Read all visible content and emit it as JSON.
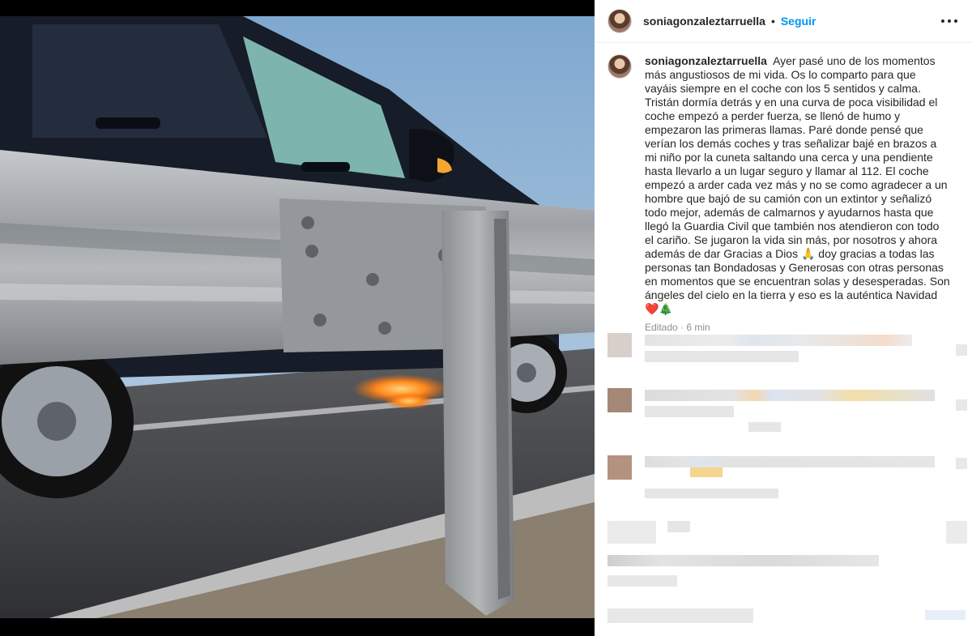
{
  "post": {
    "author": {
      "username": "soniagonzaleztarruella",
      "avatar_icon": "profile-avatar"
    },
    "header": {
      "separator": "•",
      "follow_label": "Seguir",
      "more_icon": "more-options-icon"
    },
    "caption": {
      "text": "Ayer pasé uno de los momentos más angustiosos de mi vida. Os lo comparto para que vayáis siempre en el coche con los 5 sentidos y calma. Tristán dormía detrás y en una curva de poca visibilidad el coche empezó a perder fuerza, se llenó de humo y empezaron las primeras llamas. Paré donde pensé que verían los demás coches y tras señalizar bajé en brazos a mi niño por la cuneta saltando una cerca y una pendiente hasta llevarlo a un lugar seguro y llamar al 112. El coche empezó a arder cada vez más y no se como agradecer a un hombre que bajó de su camión con un extintor y señalizó todo mejor, además de calmarnos y ayudarnos hasta que llegó la Guardia Civil que también nos atendieron con todo el cariño. Se jugaron la vida sin más, por nosotros y ahora además de dar Gracias a Dios 🙏 doy gracias a todas las personas tan Bondadosas y Generosas con otras personas en momentos que se encuentran solas y desesperadas. Son ángeles del cielo en la tierra y eso es la auténtica Navidad ❤️🎄",
      "edited_label": "Editado",
      "separator": "·",
      "time_ago": "6 min"
    },
    "photo": {
      "subject": "dark SUV behind a metal highway guardrail with flames under the car"
    },
    "colors": {
      "follow_blue": "#0095f6",
      "muted_text": "#8e8e8e",
      "divider": "#efefef"
    }
  }
}
